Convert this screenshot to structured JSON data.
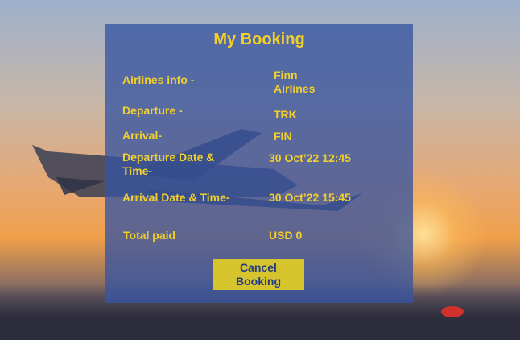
{
  "booking": {
    "title": "My Booking",
    "rows": [
      {
        "label": "Airlines info -",
        "value": "Finn Airlines"
      },
      {
        "label": "Departure -",
        "value": "TRK"
      },
      {
        "label": "Arrival-",
        "value": "FIN"
      },
      {
        "label": "Departure Date & Time-",
        "value": "30 Oct’22 12:45"
      },
      {
        "label": "Arrival Date & Time-",
        "value": "30 Oct’22 15:45"
      },
      {
        "label": "Total paid",
        "value": "USD 0"
      }
    ],
    "cancel_label": "Cancel Booking"
  },
  "colors": {
    "accent": "#f2d02b",
    "panel": "#3755a0",
    "button": "#d6c42c",
    "button_text": "#243b86"
  }
}
